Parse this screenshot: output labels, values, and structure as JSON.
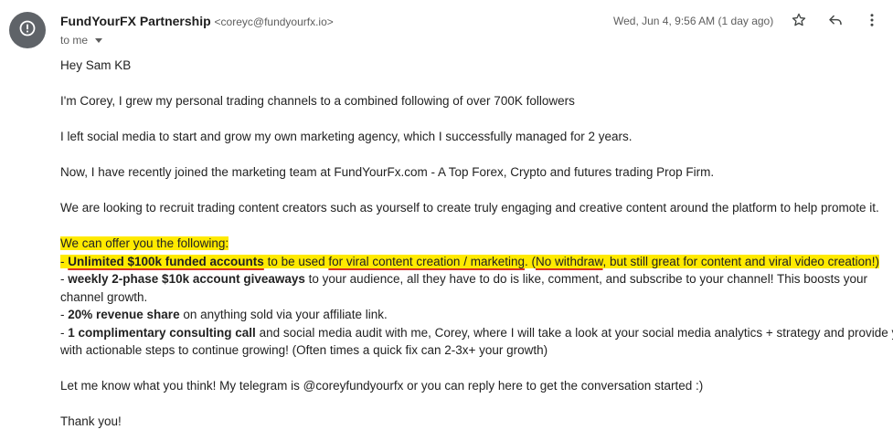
{
  "header": {
    "sender_name": "FundYourFX Partnership",
    "sender_email": "<coreyc@fundyourfx.io>",
    "to_label": "to me",
    "date": "Wed, Jun 4, 9:56 AM (1 day ago)",
    "avatar_icon": "alert-circle-icon",
    "star_icon": "star-icon",
    "reply_icon": "reply-icon",
    "more_icon": "more-vert-icon"
  },
  "body": {
    "greeting": "Hey Sam KB",
    "p1": "I'm Corey, I grew my personal trading channels to a combined following of over 700K followers",
    "p2": "I left social media to start and grow my own marketing agency, which I successfully managed for 2 years.",
    "p3": "Now, I have recently joined the marketing team at FundYourFx.com - A Top Forex, Crypto and futures trading Prop Firm.",
    "p4": "We are looking to recruit trading content creators such as yourself to create truly engaging and creative content around the platform to help promote it.",
    "offer_intro": "We can offer you the following:",
    "offer1": {
      "dash": "- ",
      "bold": "Unlimited $100k funded accounts",
      "t1": " to be used ",
      "ul1": "for viral content creation / marketing",
      "t2": ". (",
      "ul2": "No withdraw",
      "t3": ", but still great for content and viral video creation!)"
    },
    "offer2": {
      "dash": "- ",
      "bold": "weekly 2-phase $10k account giveaways",
      "t1": " to your audience, all they have to do is like, comment, and subscribe to your channel! This boosts your",
      "t2": "channel growth."
    },
    "offer3": {
      "dash": "- ",
      "bold": "20% revenue share",
      "t1": " on anything sold via your affiliate link."
    },
    "offer4": {
      "dash": "- ",
      "bold": "1 complimentary consulting call",
      "t1": " and social media audit with me, Corey, where I will take a look at your social media analytics + strategy and provide you",
      "t2": "with actionable steps to continue growing! (Often times a quick fix can 2-3x+ your growth)"
    },
    "closing": "Let me know what you think! My telegram is @coreyfundyourfx or you can reply here to get the conversation started :)",
    "signoff": "Thank you!"
  },
  "colors": {
    "highlight": "#ffea00",
    "underline": "#d93025",
    "avatar_bg": "#5f6368"
  }
}
